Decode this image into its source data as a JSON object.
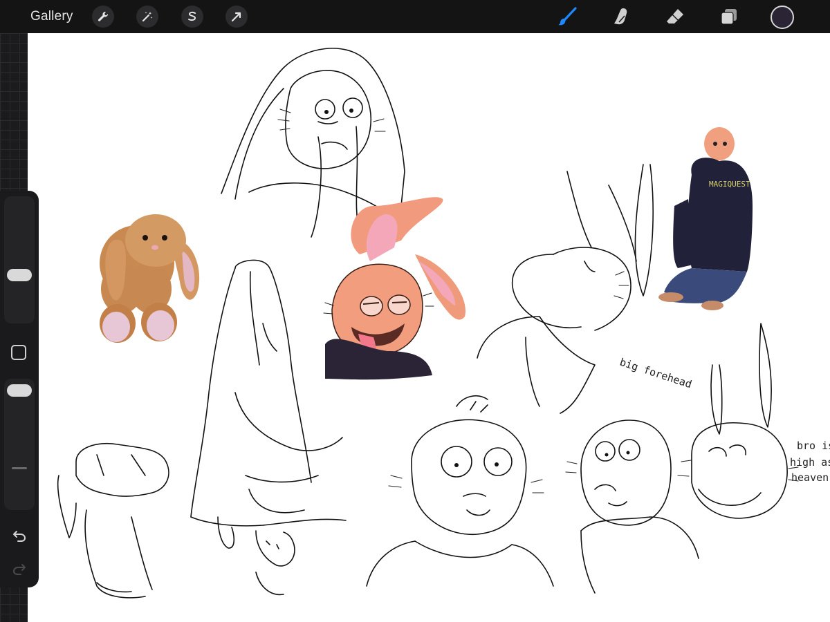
{
  "toolbar": {
    "gallery_label": "Gallery",
    "actions_icon": "wrench-icon",
    "adjustments_icon": "magic-wand-icon",
    "selection_icon": "selection-s-icon",
    "transform_icon": "arrow-cursor-icon",
    "brush_icon": "brush-icon",
    "smudge_icon": "smudge-finger-icon",
    "eraser_icon": "eraser-icon",
    "layers_icon": "layers-icon",
    "active_tool": "brush",
    "active_color": "#2a2435",
    "accent_color": "#1e88ff"
  },
  "sidebar": {
    "brush_size_level": 0.85,
    "opacity_level": 0.92,
    "undo_icon": "undo-arrow-icon",
    "redo_icon": "redo-arrow-icon"
  },
  "canvas": {
    "notes": {
      "forehead": "big forehead",
      "high_line1": "bro is",
      "high_line2": "high as",
      "high_line3": "heaven"
    },
    "hoodie_text": "MAGIQUEST"
  }
}
